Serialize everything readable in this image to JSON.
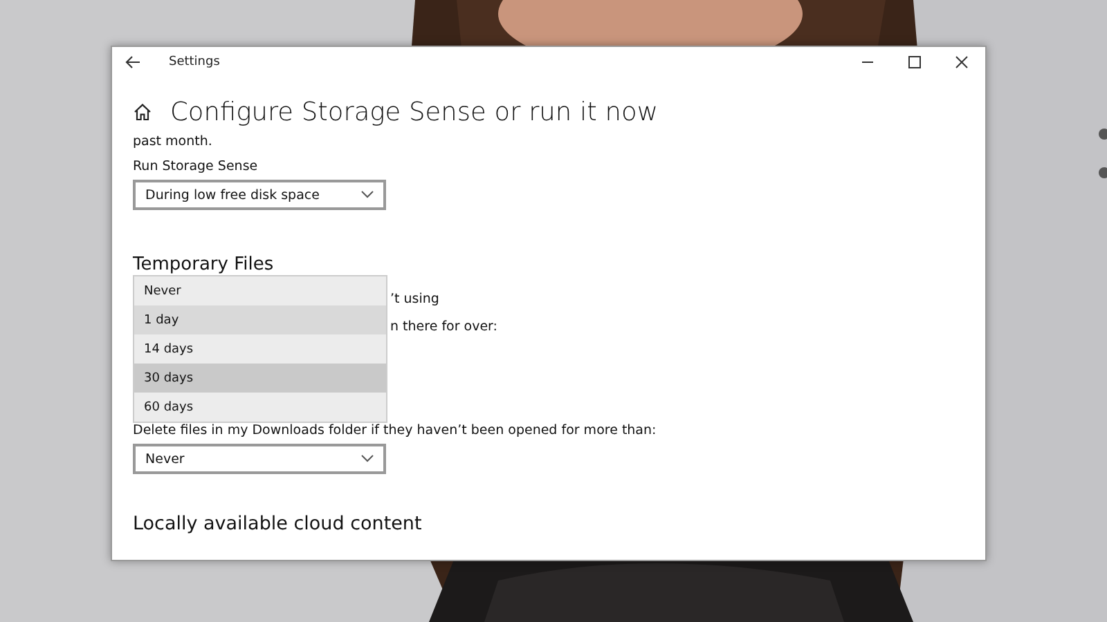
{
  "window": {
    "title": "Settings"
  },
  "page": {
    "title": "Configure Storage Sense or run it now"
  },
  "intro_tail": "past month.",
  "run_storage_sense": {
    "label": "Run Storage Sense",
    "value": "During low free disk space"
  },
  "temporary_files": {
    "heading": "Temporary Files",
    "partial_lines": [
      "’t using",
      "n there for over:"
    ],
    "downloads": {
      "label": "Delete files in my Downloads folder if they haven’t been opened for more than:",
      "value": "Never"
    }
  },
  "dropdown_menu": {
    "options": [
      {
        "label": "Never",
        "selected": false,
        "hovered": false
      },
      {
        "label": "1 day",
        "selected": false,
        "hovered": true
      },
      {
        "label": "14 days",
        "selected": false,
        "hovered": false
      },
      {
        "label": "30 days",
        "selected": true,
        "hovered": false
      },
      {
        "label": "60 days",
        "selected": false,
        "hovered": false
      }
    ]
  },
  "cloud_content": {
    "heading": "Locally available cloud content"
  }
}
